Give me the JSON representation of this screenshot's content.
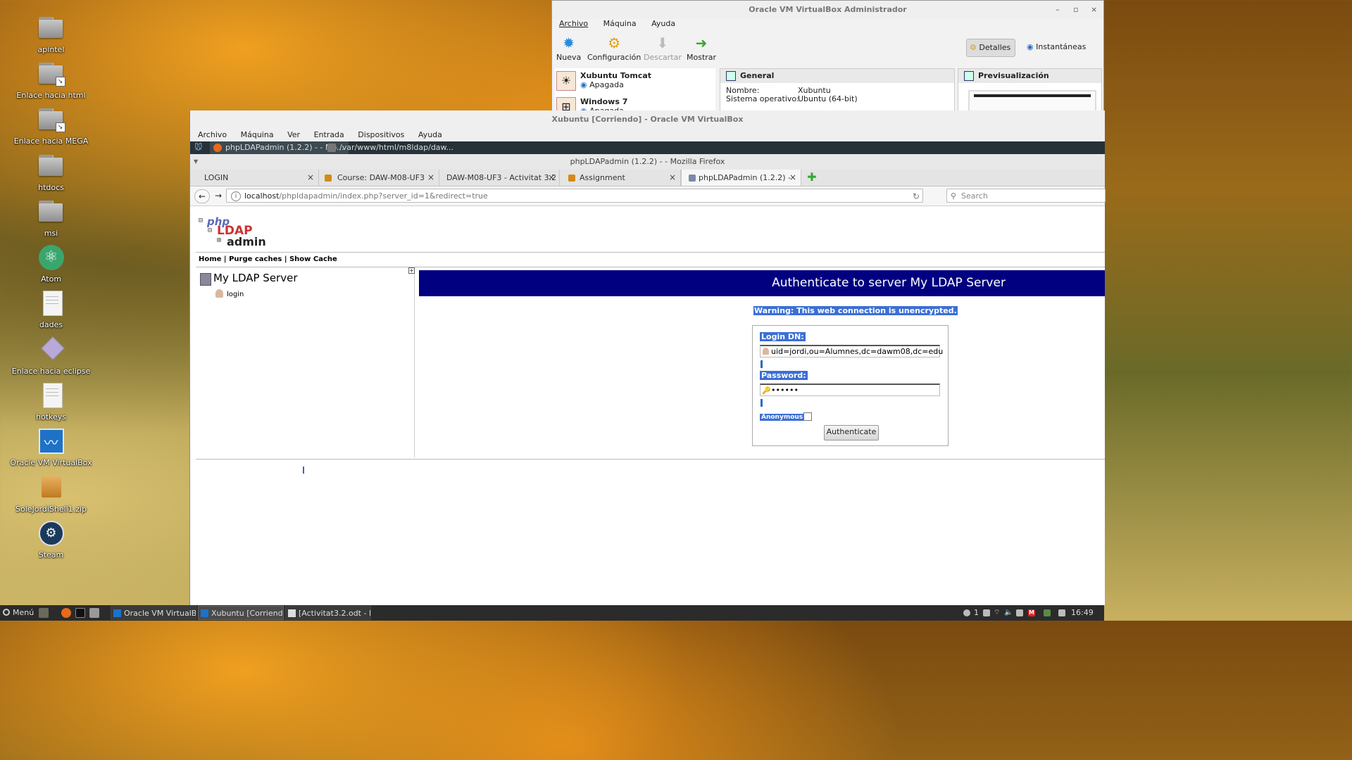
{
  "desktop": {
    "icons": [
      {
        "label": "apintel",
        "icon": "folder-icon"
      },
      {
        "label": "Enlace hacia html",
        "icon": "folder-link-icon"
      },
      {
        "label": "Enlace hacia MEGA",
        "icon": "folder-link-icon"
      },
      {
        "label": "htdocs",
        "icon": "folder-icon"
      },
      {
        "label": "msi",
        "icon": "folder-icon"
      },
      {
        "label": "Atom",
        "icon": "atom-icon"
      },
      {
        "label": "dades",
        "icon": "document-icon"
      },
      {
        "label": "Enlace hacia eclipse",
        "icon": "eclipse-link-icon"
      },
      {
        "label": "hotkeys",
        "icon": "document-icon"
      },
      {
        "label": "Oracle VM VirtualBox",
        "icon": "virtualbox-icon"
      },
      {
        "label": "SoleJordiShell1.zip",
        "icon": "zip-icon"
      },
      {
        "label": "Steam",
        "icon": "steam-icon"
      }
    ]
  },
  "vbox_manager": {
    "title": "Oracle VM VirtualBox Administrador",
    "menu": [
      "Archivo",
      "Máquina",
      "Ayuda"
    ],
    "tools": [
      {
        "label": "Nueva",
        "enabled": true
      },
      {
        "label": "Configuración",
        "enabled": true
      },
      {
        "label": "Descartar",
        "enabled": false
      },
      {
        "label": "Mostrar",
        "enabled": true
      }
    ],
    "detalles_label": "Detalles",
    "instantaneas_label": "Instantáneas",
    "vms": [
      {
        "name": "Xubuntu Tomcat",
        "state": "Apagada"
      },
      {
        "name": "Windows 7",
        "state": "Apagada"
      }
    ],
    "general": {
      "title": "General",
      "nombre_label": "Nombre:",
      "nombre_value": "Xubuntu",
      "so_label": "Sistema operativo:",
      "so_value": "Ubuntu (64-bit)"
    },
    "preview_title": "Previsualización"
  },
  "vm_window": {
    "title": "Xubuntu [Corriendo] - Oracle VM VirtualBox",
    "menu": [
      "Archivo",
      "Máquina",
      "Ver",
      "Entrada",
      "Dispositivos",
      "Ayuda"
    ],
    "guest_tasks": [
      {
        "label": "phpLDAPadmin (1.2.2) - - Mo..."
      },
      {
        "label": "/var/www/html/m8ldap/daw..."
      }
    ]
  },
  "firefox": {
    "title": "phpLDAPadmin (1.2.2) - - Mozilla Firefox",
    "tabs": [
      {
        "label": "LOGIN"
      },
      {
        "label": "Course: DAW-M08-UF3 A..."
      },
      {
        "label": "DAW-M08-UF3 - Activitat 3.2 ..."
      },
      {
        "label": "Assignment"
      },
      {
        "label": "phpLDAPadmin (1.2.2) -"
      }
    ],
    "url_host": "localhost",
    "url_path": "/phpldapadmin/index.php?server_id=1&redirect=true",
    "search_placeholder": "Search"
  },
  "pla": {
    "logo": {
      "php": "php",
      "ldap": "LDAP",
      "admin": "admin"
    },
    "links": {
      "home": "Home",
      "sep1": " | ",
      "purge": "Purge caches",
      "sep2": " | ",
      "show": "Show Cache"
    },
    "server_name": "My LDAP Server",
    "login_link": "login",
    "auth_title": "Authenticate to server My LDAP Server",
    "warning": "Warning: This web connection is unencrypted.",
    "login_dn_label": "Login DN:",
    "login_dn_value": "uid=jordi,ou=Alumnes,dc=dawm08,dc=edu",
    "password_label": "Password:",
    "password_value": "••••••",
    "anonymous_label": "Anonymous",
    "authenticate_label": "Authenticate"
  },
  "taskbar": {
    "menu_label": "Menú",
    "tasks": [
      {
        "label": "Oracle VM VirtualBo..."
      },
      {
        "label": "Xubuntu [Corriendo..."
      },
      {
        "label": "[Activitat3.2.odt - Li..."
      }
    ],
    "notification_count": "1",
    "clock": "16:49"
  }
}
